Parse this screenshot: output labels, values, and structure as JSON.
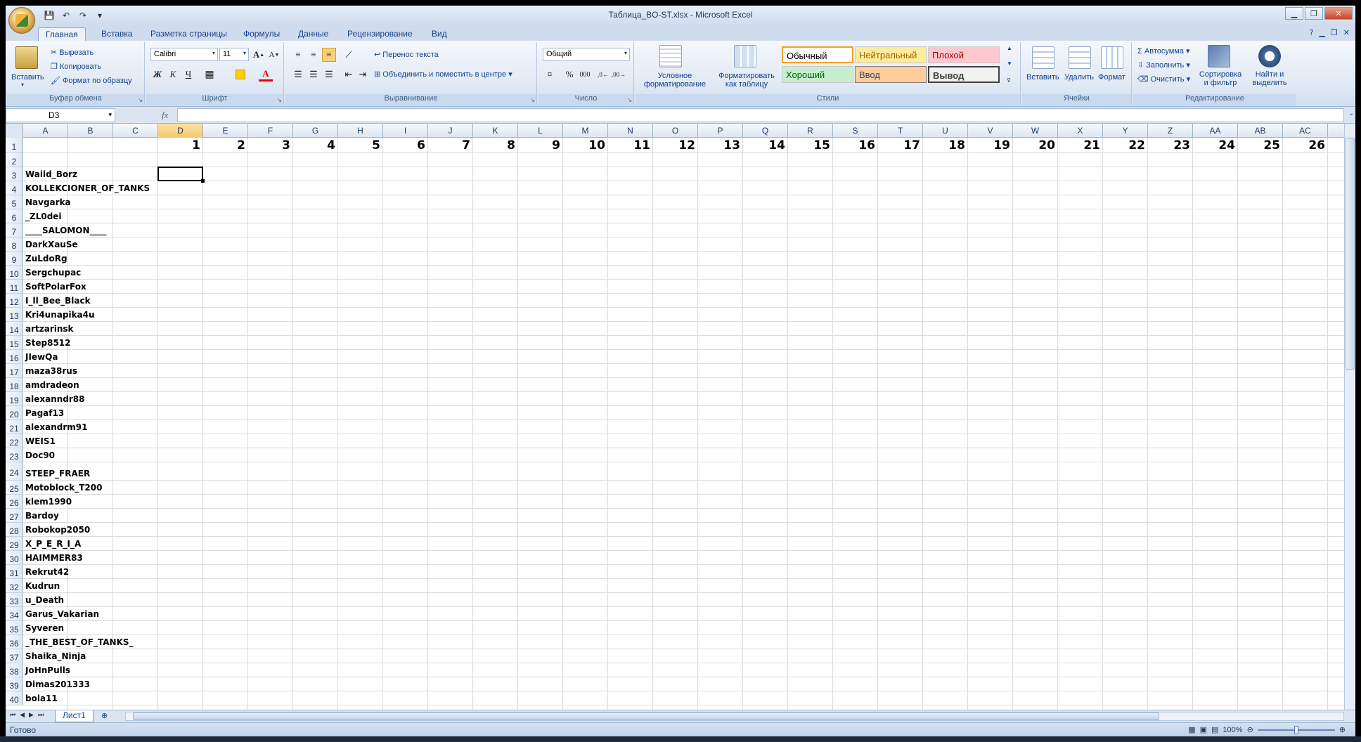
{
  "window": {
    "title": "Таблица_BO-ST.xlsx - Microsoft Excel"
  },
  "tabs": [
    "Главная",
    "Вставка",
    "Разметка страницы",
    "Формулы",
    "Данные",
    "Рецензирование",
    "Вид"
  ],
  "ribbon": {
    "clipboard": {
      "paste": "Вставить",
      "cut": "Вырезать",
      "copy": "Копировать",
      "format_painter": "Формат по образцу",
      "label": "Буфер обмена"
    },
    "font": {
      "name": "Calibri",
      "size": "11",
      "bold": "Ж",
      "italic": "К",
      "underline": "Ч",
      "label": "Шрифт"
    },
    "alignment": {
      "wrap": "Перенос текста",
      "merge": "Объединить и поместить в центре",
      "label": "Выравнивание"
    },
    "number": {
      "format": "Общий",
      "label": "Число"
    },
    "styles": {
      "conditional": [
        "Условное",
        "форматирование"
      ],
      "as_table": [
        "Форматировать",
        "как таблицу"
      ],
      "normal": "Обычный",
      "neutral": "Нейтральный",
      "bad": "Плохой",
      "good": "Хороший",
      "input": "Ввод",
      "output": "Вывод",
      "label": "Стили"
    },
    "cells": {
      "insert": "Вставить",
      "delete": "Удалить",
      "format": "Формат",
      "label": "Ячейки"
    },
    "editing": {
      "autosum": "Автосумма",
      "fill": "Заполнить",
      "clear": "Очистить",
      "sort": [
        "Сортировка",
        "и фильтр"
      ],
      "find": [
        "Найти и",
        "выделить"
      ],
      "label": "Редактирование"
    }
  },
  "formula_bar": {
    "name_box": "D3",
    "fx": "fx",
    "value": ""
  },
  "columns": [
    "A",
    "B",
    "C",
    "D",
    "E",
    "F",
    "G",
    "H",
    "I",
    "J",
    "K",
    "L",
    "M",
    "N",
    "O",
    "P",
    "Q",
    "R",
    "S",
    "T",
    "U",
    "V",
    "W",
    "X",
    "Y",
    "Z",
    "AA",
    "AB",
    "AC"
  ],
  "header_numbers": [
    "1",
    "2",
    "3",
    "4",
    "5",
    "6",
    "7",
    "8",
    "9",
    "10",
    "11",
    "12",
    "13",
    "14",
    "15",
    "16",
    "17",
    "18",
    "19",
    "20",
    "21",
    "22",
    "23",
    "24",
    "25",
    "26"
  ],
  "row_numbers": [
    "1",
    "2",
    "3",
    "4",
    "5",
    "6",
    "7",
    "8",
    "9",
    "10",
    "11",
    "12",
    "13",
    "14",
    "15",
    "16",
    "17",
    "18",
    "19",
    "20",
    "21",
    "22",
    "23",
    "24",
    "25",
    "26",
    "27",
    "28",
    "29",
    "30",
    "31",
    "32",
    "33",
    "34",
    "35",
    "36",
    "37",
    "38",
    "39",
    "40"
  ],
  "names": [
    "Waild_Borz",
    "KOLLEKCIONER_OF_TANKS",
    "Navgarka",
    "_ZL0dei",
    "____SALOMON____",
    "DarkXauSe",
    "ZuLdoRg",
    "Sergchupac",
    "SoftPolarFox",
    "I_ll_Bee_Black",
    "Kri4unapika4u",
    "artzarinsk",
    "Step8512",
    "JIewQa",
    "maza38rus",
    "amdradeon",
    "alexanndr88",
    "Pagaf13",
    "alexandrm91",
    "WEIS1",
    "Doc90",
    "STEEP_FRAER",
    "Motoblock_T200",
    "klem1990",
    "Bardoy",
    "Robokop2050",
    "X_P_E_R_I_A",
    "HAIMMER83",
    "Rekrut42",
    "Kudrun",
    "u_Death",
    "Garus_Vakarian",
    "Syveren",
    "_THE_BEST_OF_TANKS_",
    "Shaika_Ninja",
    "JoHnPulls",
    "Dimas201333",
    "bola11"
  ],
  "sheet": {
    "tab": "Лист1"
  },
  "status": {
    "text": "Готово",
    "zoom": "100%"
  },
  "colors": {
    "selected_col": "#f3c76b",
    "grid": "#dadcdd",
    "header": "#dde6f1"
  }
}
